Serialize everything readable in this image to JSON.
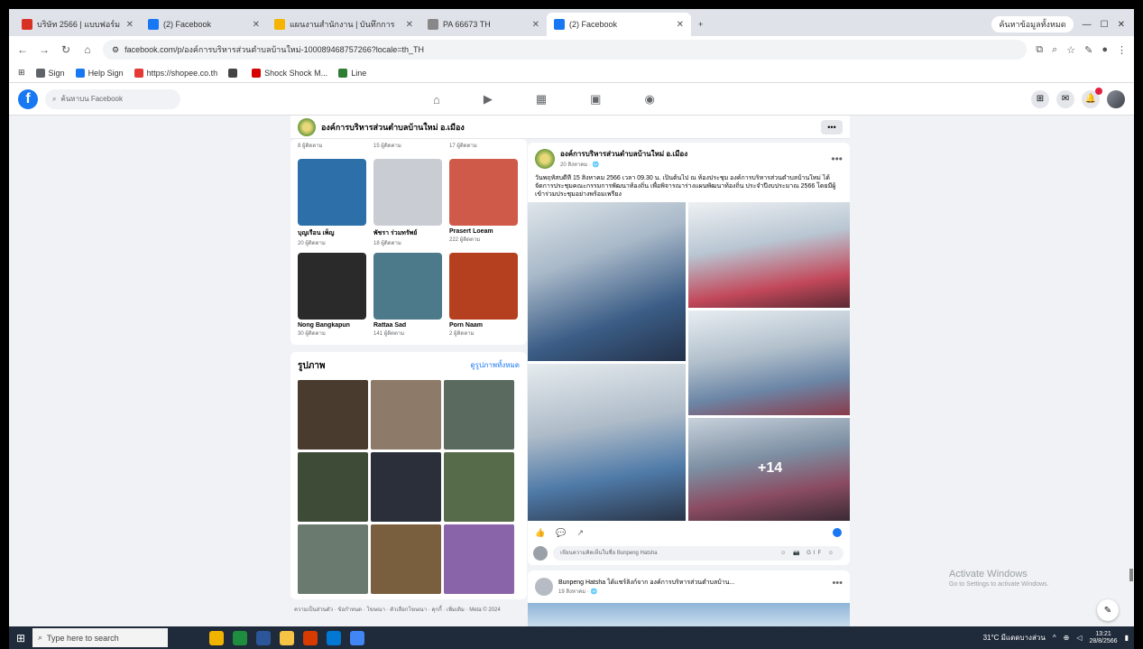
{
  "browser": {
    "tabs": [
      {
        "label": "บริษัท 2566 | แบบฟอร์ม",
        "color": "#d93025"
      },
      {
        "label": "(2) Facebook",
        "color": "#1877f2"
      },
      {
        "label": "แผนงานสำนักงาน | บันทึกการ",
        "color": "#f6b400"
      },
      {
        "label": "PA 66673 TH",
        "color": "#888888"
      },
      {
        "label": "(2) Facebook",
        "color": "#1877f2"
      }
    ],
    "profile_label": "ค้นหาข้อมูลทั้งหมด",
    "url": "facebook.com/p/องค์การบริหารส่วนตำบลบ้านใหม่-100089468757266?locale=th_TH",
    "bookmarks": [
      {
        "label": "Sign",
        "color": "#5f6368"
      },
      {
        "label": "Help Sign",
        "color": "#1877f2"
      },
      {
        "label": "https://shopee.co.th",
        "color": "#e53935"
      },
      {
        "label": "",
        "color": "#444444"
      },
      {
        "label": "Shock Shock M...",
        "color": "#d50000"
      },
      {
        "label": "Line",
        "color": "#2e7d32"
      }
    ]
  },
  "facebook": {
    "logo": "f",
    "search_placeholder": "ค้นหาบน Facebook",
    "nav_icons": [
      "home-icon",
      "video-icon",
      "marketplace-icon",
      "groups-icon",
      "gaming-icon"
    ],
    "page_name": "องค์การบริหารส่วนตำบลบ้านใหม่ อ.เมือง",
    "more_label": "•••"
  },
  "friends": {
    "cut_row": [
      "8 ผู้ติดตาม",
      "15 ผู้ติดตาม",
      "17 ผู้ติดตาม"
    ],
    "items": [
      {
        "name": "บุญเรือน เพ็ญ",
        "meta": "20 ผู้ติดตาม",
        "color": "#2d6fa8"
      },
      {
        "name": "พัชรา ร่วมทรัพย์",
        "meta": "18 ผู้ติดตาม",
        "color": "#c9cdd3"
      },
      {
        "name": "Prasert Loeam",
        "meta": "222 ผู้ติดตาม",
        "color": "#cf5a4a"
      },
      {
        "name": "Nong Bangkapun",
        "meta": "30 ผู้ติดตาม",
        "color": "#2a2a2a"
      },
      {
        "name": "Rattaa Sad",
        "meta": "141 ผู้ติดตาม",
        "color": "#4c7a8a"
      },
      {
        "name": "Porn Naam",
        "meta": "2 ผู้ติดตาม",
        "color": "#b5401f"
      }
    ]
  },
  "photos": {
    "title": "รูปภาพ",
    "see_all": "ดูรูปภาพทั้งหมด",
    "tiles": [
      "#4a3b2f",
      "#8d7a68",
      "#5a6a5e",
      "#3e4b36",
      "#2a2f3a",
      "#556b4a",
      "#6b7a6f",
      "#7a5f3e",
      "#8a64a8"
    ]
  },
  "footer": "ความเป็นส่วนตัว · ข้อกำหนด · โฆษณา · ตัวเลือกโฆษณา · คุกกี้ · เพิ่มเติม · Meta © 2024",
  "post": {
    "author": "องค์การบริหารส่วนตำบลบ้านใหม่ อ.เมือง",
    "date": "20 สิงหาคม · 🌐",
    "text": "วันพฤหัสบดีที่ 15 สิงหาคม 2566 เวลา 09.30 น. เป็นต้นไป ณ ห้องประชุม องค์การบริหารส่วนตำบลบ้านใหม่ ได้จัดการประชุมคณะกรรมการพัฒนาท้องถิ่น เพื่อพิจารณาร่างแผนพัฒนาท้องถิ่น ประจำปีงบประมาณ 2566 โดยมีผู้เข้าร่วมประชุมอย่างพร้อมเพรียง",
    "more_photos": "+14",
    "actions": [
      "👍",
      "💬",
      "↗"
    ],
    "comment_placeholder": "เขียนความคิดเห็นในชื่อ Bunpeng Hatsha",
    "comment_icons": "☺ 📷 GIF ☺"
  },
  "post2": {
    "author": "Bunpeng Hatsha ได้แชร์ลิงก์จาก องค์การบริหารส่วนตำบลบ้าน...",
    "date": "19 สิงหาคม · 🌐"
  },
  "activate": {
    "title": "Activate Windows",
    "subtitle": "Go to Settings to activate Windows."
  },
  "taskbar": {
    "search_placeholder": "Type here to search",
    "apps": [
      "#f0b400",
      "#1e8e3e",
      "#2b579a",
      "#f6c344",
      "#d83b01",
      "#0078d4",
      "#4285f4"
    ],
    "weather": "31°C มีแดดบางส่วน",
    "time": "13:21",
    "date": "28/8/2566"
  }
}
